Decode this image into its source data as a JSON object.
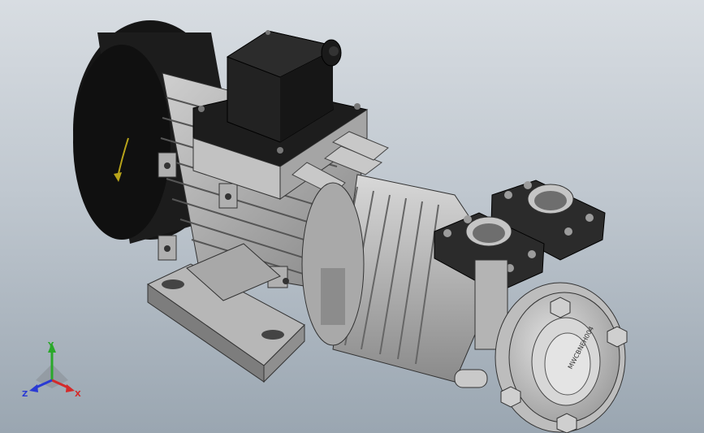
{
  "viewport": {
    "background_top": "#d8dde2",
    "background_bottom": "#9aa6b1"
  },
  "model": {
    "nameplate_text": "MWCBNEH004",
    "rotation_arrow_color": "#b8a41a"
  },
  "triad": {
    "x_label": "X",
    "y_label": "Y",
    "z_label": "Z",
    "x_color": "#d42a2a",
    "y_color": "#2aa82a",
    "z_color": "#2a3ad4"
  }
}
